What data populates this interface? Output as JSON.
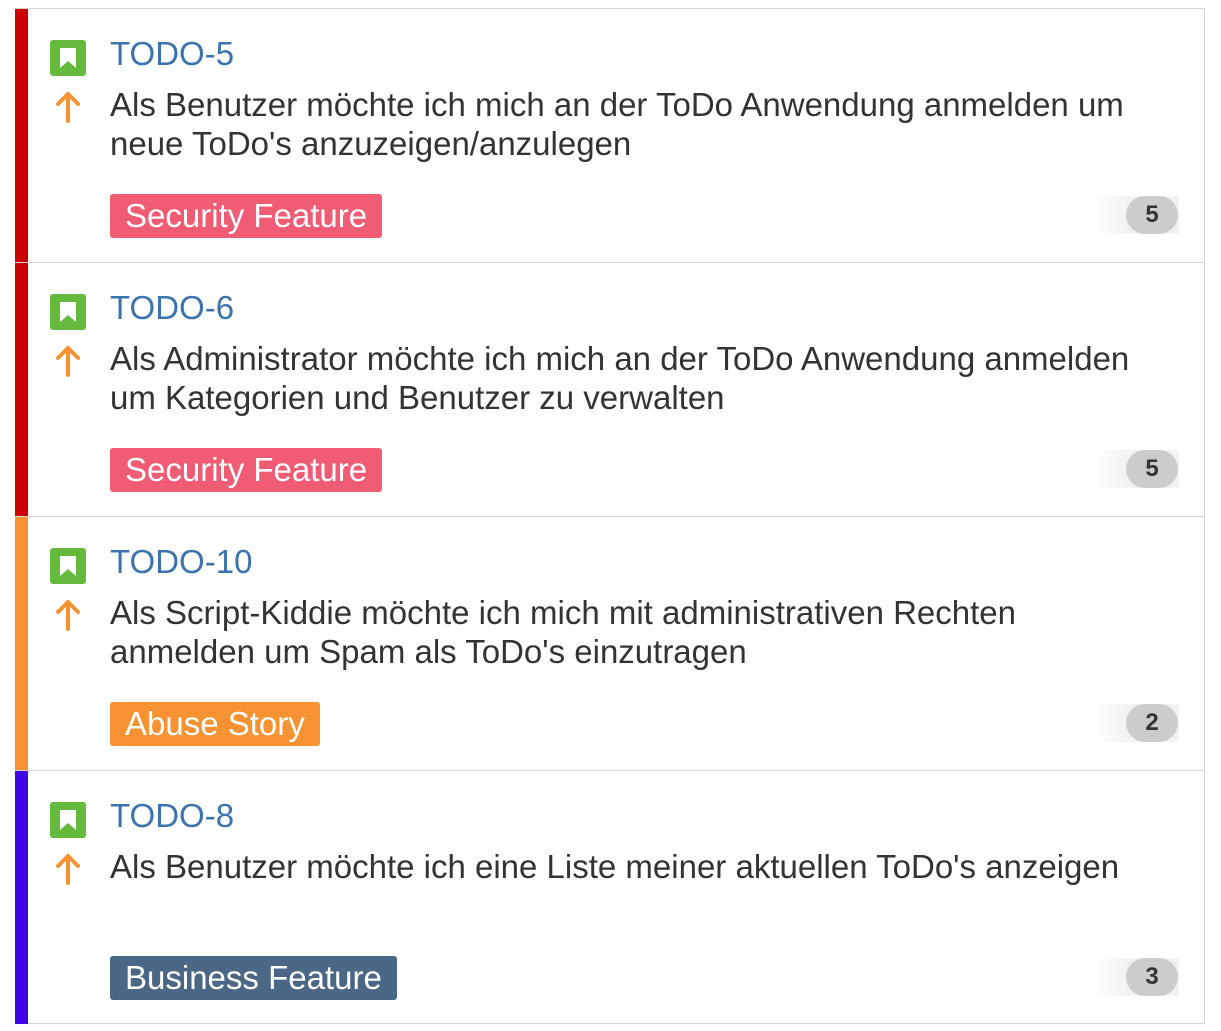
{
  "colors": {
    "issue_type_story": "#63ba3c",
    "priority_major": "#f79232",
    "link": "#3b73af"
  },
  "issue_type_icon": "story-bookmark-icon",
  "priority_icon": "arrow-up-icon",
  "cards": [
    {
      "key": "TODO-5",
      "summary": "Als Benutzer möchte ich mich an der ToDo Anwendung anmelden um neue ToDo's anzuzeigen/anzulegen",
      "epic": "Security Feature",
      "epic_color": "#f15c75",
      "stripe_color": "#cc0000",
      "estimate": "5"
    },
    {
      "key": "TODO-6",
      "summary": "Als Administrator möchte ich mich an der ToDo Anwendung anmelden um Kategorien und Benutzer zu verwalten",
      "epic": "Security Feature",
      "epic_color": "#f15c75",
      "stripe_color": "#cc0000",
      "estimate": "5"
    },
    {
      "key": "TODO-10",
      "summary": "Als Script-Kiddie möchte ich mich mit administrativen Rechten anmelden um Spam als ToDo's einzutragen",
      "epic": "Abuse Story",
      "epic_color": "#f79232",
      "stripe_color": "#f79232",
      "estimate": "2"
    },
    {
      "key": "TODO-8",
      "summary": "Als Benutzer möchte ich eine Liste meiner aktuellen ToDo's anzeigen",
      "epic": "Business Feature",
      "epic_color": "#4a6785",
      "stripe_color": "#3f06e5",
      "estimate": "3"
    }
  ]
}
